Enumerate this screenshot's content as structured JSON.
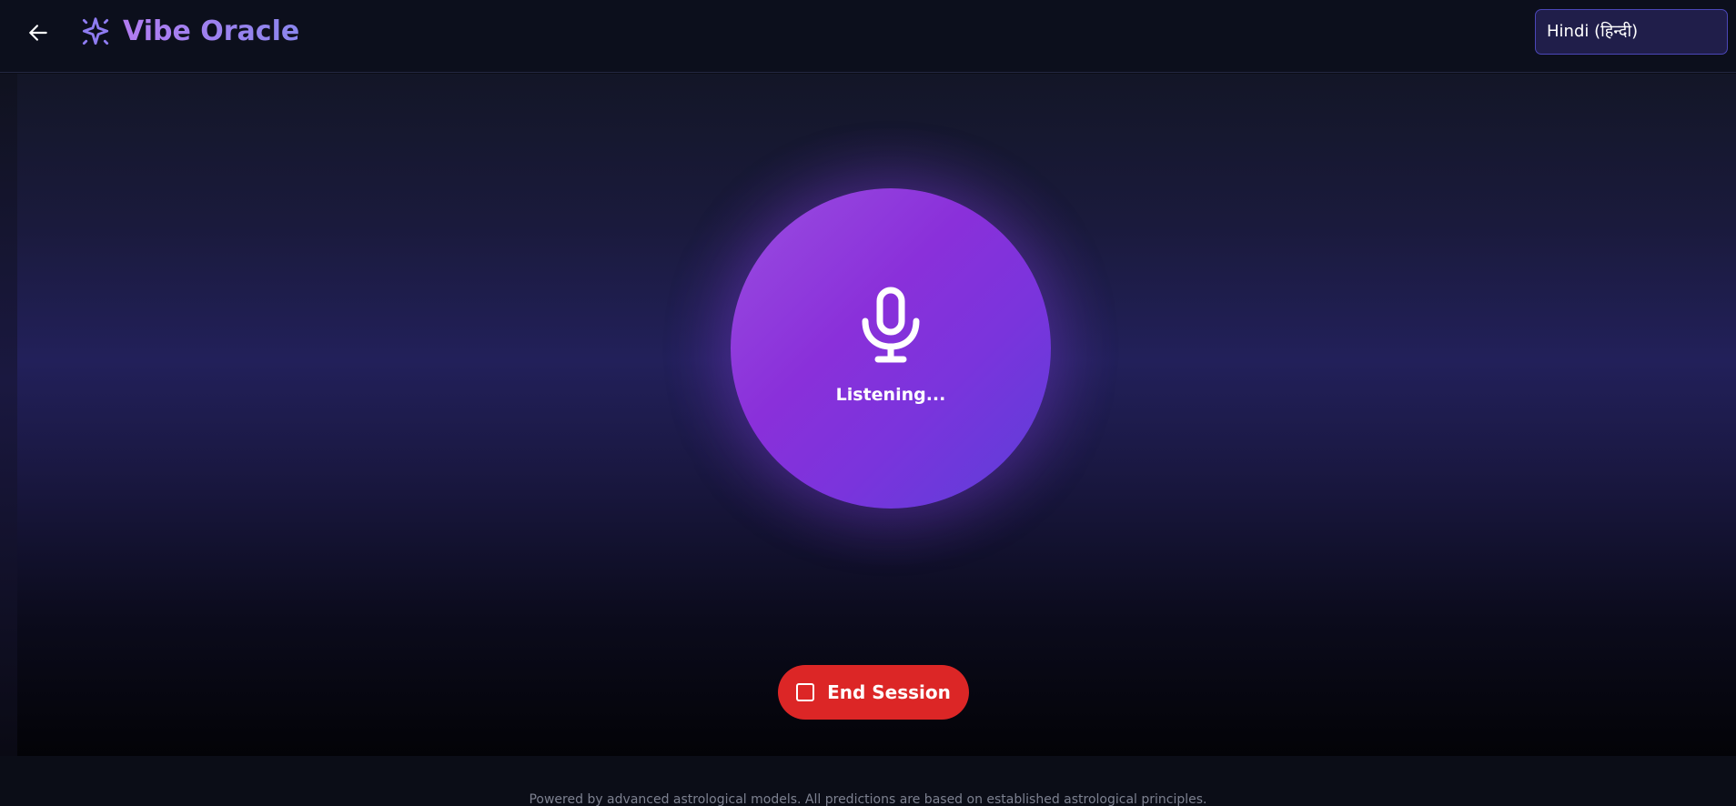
{
  "header": {
    "back_icon": "arrow-left-icon",
    "logo_icon": "sparkles-icon",
    "brand": "Vibe Oracle",
    "language_selected": "Hindi (हिन्दी)"
  },
  "orb": {
    "icon": "microphone-icon",
    "status": "Listening..."
  },
  "actions": {
    "end_icon": "stop-square-icon",
    "end_label": "End Session"
  },
  "footer": {
    "text": "Powered by advanced astrological models. All predictions are based on established astrological principles."
  },
  "colors": {
    "accent": "#8a30da",
    "brand_start": "#b27cf0",
    "brand_end": "#8a86ee",
    "danger": "#dc2626",
    "background": "#0b0d17"
  }
}
